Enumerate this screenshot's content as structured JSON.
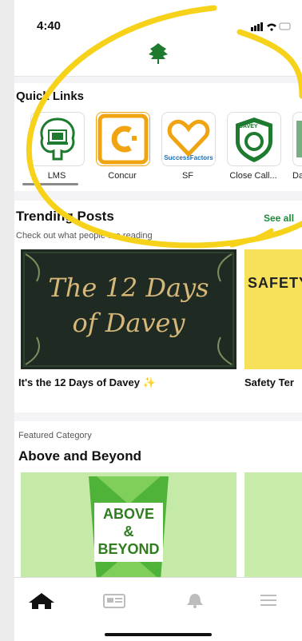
{
  "status_bar": {
    "time": "4:40"
  },
  "quick_links": {
    "title": "Quick Links",
    "items": [
      {
        "label": "LMS",
        "icon": "lms-tree-icon"
      },
      {
        "label": "Concur",
        "icon": "concur-icon"
      },
      {
        "label": "SF",
        "icon": "successfactors-heart-icon",
        "badge_text": "SuccessFactors"
      },
      {
        "label": "Close Call...",
        "icon": "davey-close-call-icon",
        "badge_text": "DAVEY"
      },
      {
        "label": "Da",
        "icon": "davey-partial-icon"
      }
    ]
  },
  "trending": {
    "title": "Trending Posts",
    "see_all": "See all",
    "subtitle": "Check out what people are reading",
    "posts": [
      {
        "image_text_line1": "The 12 Days",
        "image_text_line2": "of Davey",
        "caption": "It's the 12 Days of Davey ✨"
      },
      {
        "image_text": "SAFETY",
        "caption": "Safety Ter"
      }
    ]
  },
  "featured": {
    "label": "Featured Category",
    "title": "Above and Beyond",
    "image_lines": [
      "ABOVE",
      "&",
      "BEYOND"
    ]
  },
  "tabbar": {
    "tabs": [
      {
        "name": "home",
        "icon": "home-icon",
        "active": true
      },
      {
        "name": "news",
        "icon": "news-icon"
      },
      {
        "name": "notifications",
        "icon": "bell-icon"
      },
      {
        "name": "menu",
        "icon": "menu-icon"
      }
    ]
  },
  "colors": {
    "accent_green": "#1c8b3a",
    "highlight_yellow": "#f7d21b",
    "concur_orange": "#f0a411",
    "sf_orange": "#f0a411"
  }
}
